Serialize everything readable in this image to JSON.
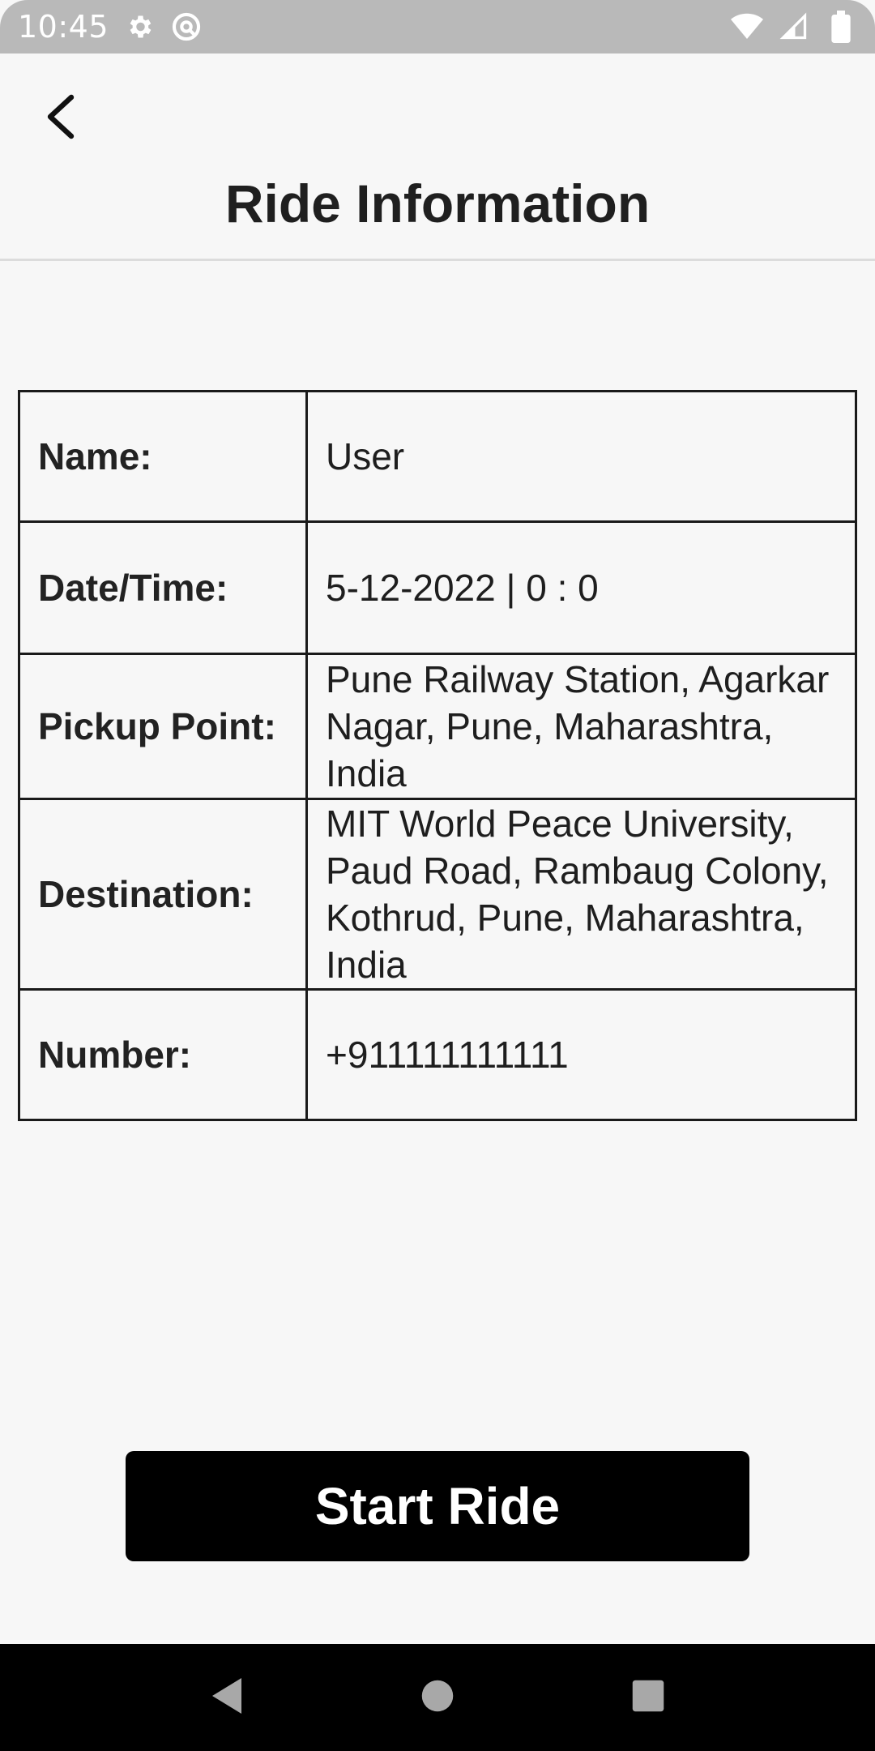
{
  "status_bar": {
    "time": "10:45",
    "icons": [
      "gear-icon",
      "at-sign-icon",
      "wifi-icon",
      "signal-icon",
      "battery-icon"
    ]
  },
  "header": {
    "back_icon": "back-arrow-icon",
    "title": "Ride Information"
  },
  "ride_info": {
    "rows": [
      {
        "label": "Name:",
        "value": "User"
      },
      {
        "label": "Date/Time:",
        "value": "5-12-2022 | 0 : 0"
      },
      {
        "label": "Pickup Point:",
        "value": "Pune Railway Station, Agarkar Nagar, Pune, Maharashtra, India"
      },
      {
        "label": "Destination:",
        "value": "MIT World Peace University, Paud Road, Rambaug Colony, Kothrud, Pune, Maharashtra, India"
      },
      {
        "label": "Number:",
        "value": "+911111111111"
      }
    ]
  },
  "actions": {
    "start_ride_label": "Start Ride"
  },
  "nav_bar": {
    "icons": [
      "nav-back-icon",
      "nav-home-icon",
      "nav-recents-icon"
    ]
  },
  "colors": {
    "background": "#f7f7f7",
    "status_bar": "#b9b9b9",
    "button": "#000000",
    "button_text": "#ffffff",
    "table_border": "#1a1a1a"
  }
}
